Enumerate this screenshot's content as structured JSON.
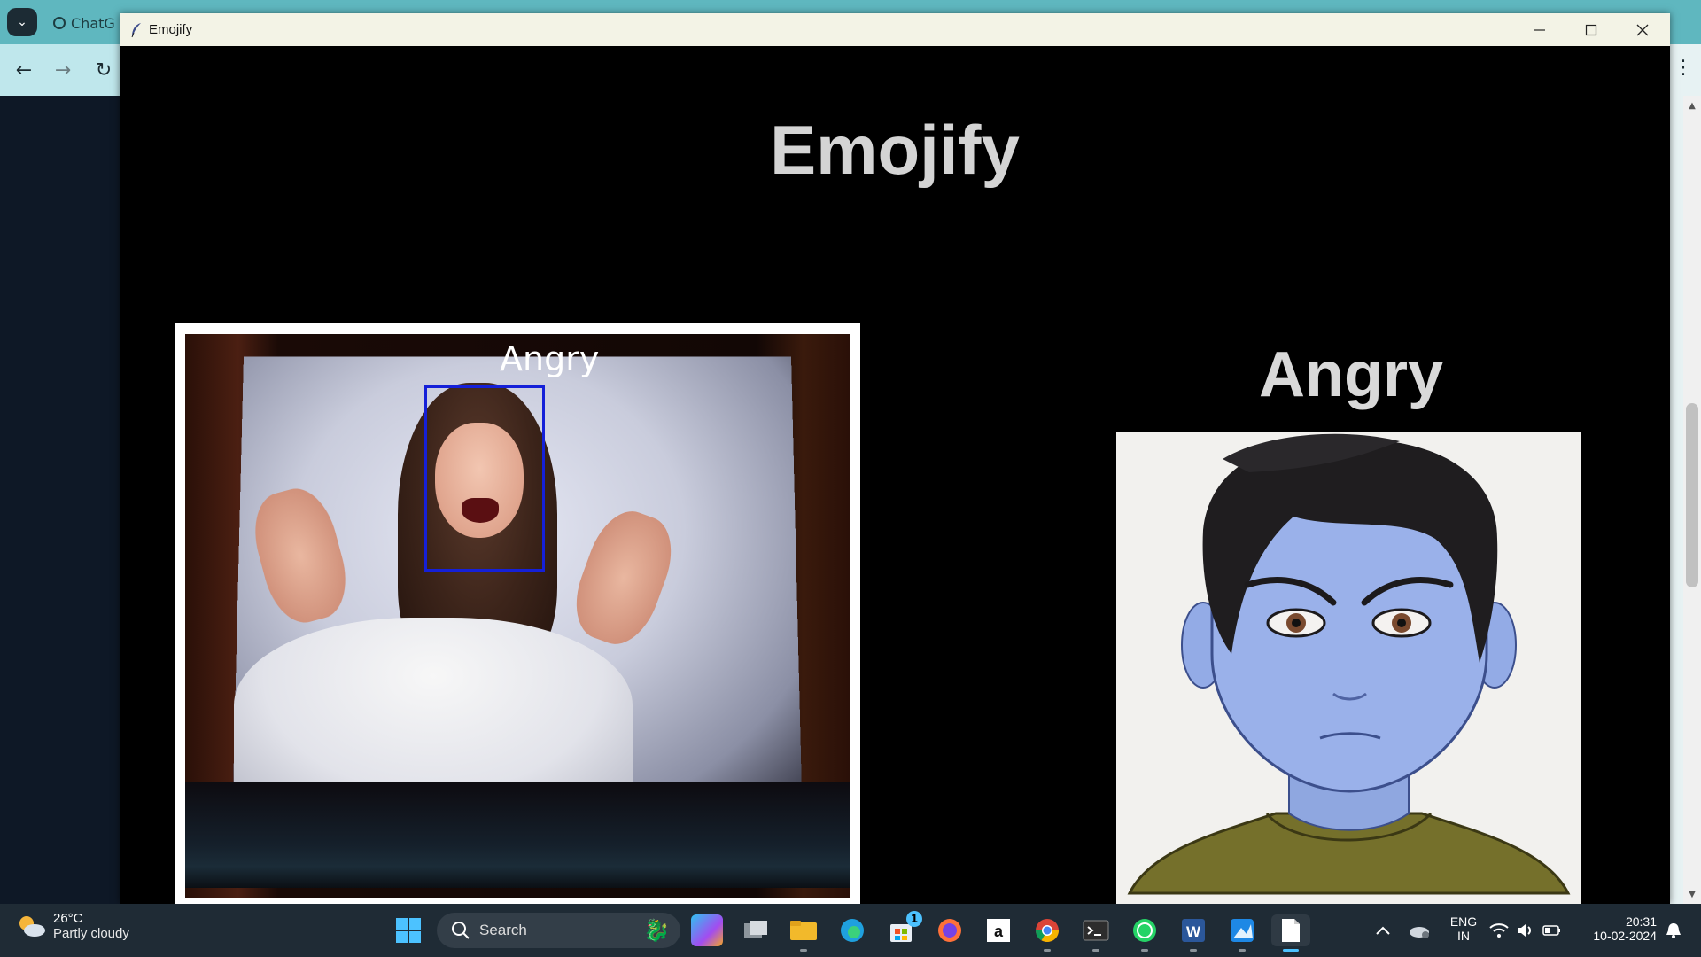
{
  "browser": {
    "tab_title": "ChatG"
  },
  "window": {
    "title": "Emojify",
    "controls": [
      "minimize",
      "maximize",
      "close"
    ]
  },
  "app": {
    "heading": "Emojify",
    "webcam": {
      "overlay_label": "Angry",
      "box_color": "#1520d8"
    },
    "emotion_label": "Angry",
    "emoji_name": "angry-face-avatar"
  },
  "taskbar": {
    "weather": {
      "temp": "26°C",
      "condition": "Partly cloudy"
    },
    "search_placeholder": "Search",
    "store_badge": "1",
    "language": {
      "line1": "ENG",
      "line2": "IN"
    },
    "time": "20:31",
    "date": "10-02-2024",
    "apps": [
      "start-icon",
      "search",
      "copilot-icon",
      "task-view-icon",
      "file-explorer-icon",
      "edge-icon",
      "store-icon",
      "firefox-icon",
      "amazon-icon",
      "chrome-icon",
      "terminal-icon",
      "whatsapp-icon",
      "word-icon",
      "photos-icon",
      "notepad-icon"
    ]
  },
  "colors": {
    "window_bg": "#000000",
    "heading_text": "#d4d4d4",
    "titlebar_bg": "#f3f3e6",
    "taskbar_bg": "#1f2b35",
    "browser_accent": "#5fb7bf"
  }
}
